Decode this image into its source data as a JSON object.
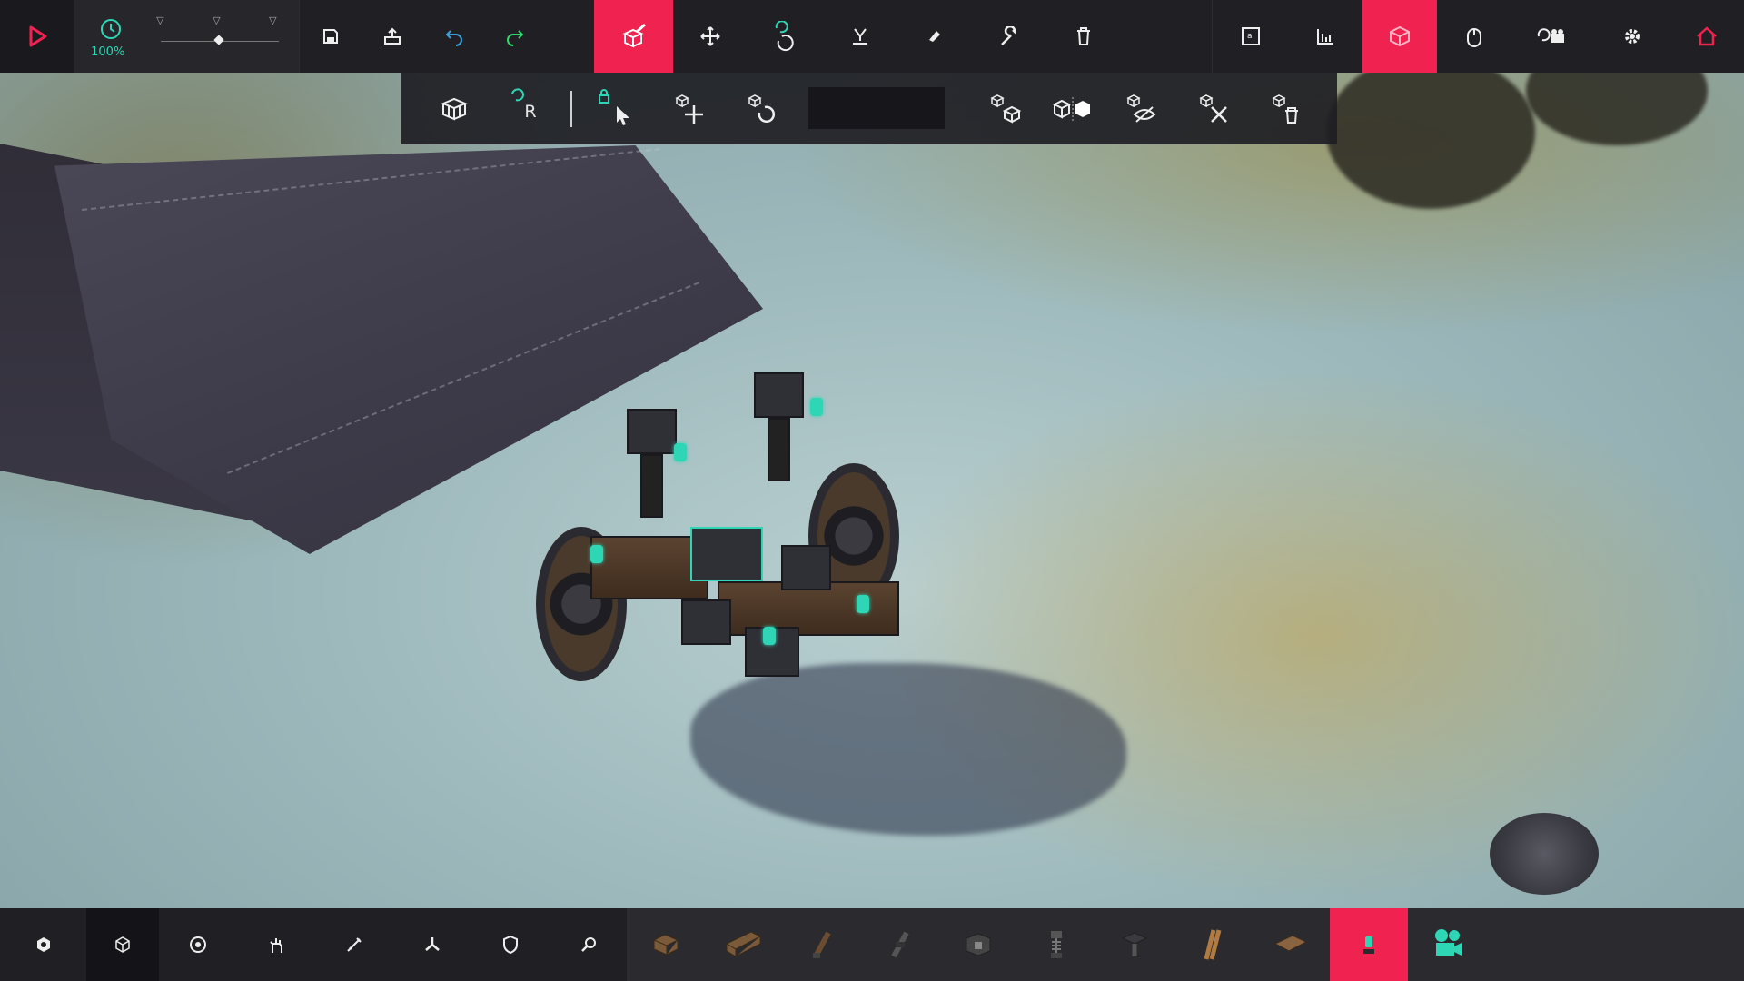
{
  "app": {
    "accent": "#f0224f",
    "teal": "#2ed6b5"
  },
  "topbar": {
    "play": "play-icon",
    "time_scale_label": "100%",
    "undo": "undo-icon",
    "redo": "redo-icon",
    "tools": [
      "build-icon",
      "move-icon",
      "rotate-icon",
      "snap-icon",
      "paint-icon",
      "wrench-icon",
      "delete-icon"
    ],
    "right": [
      "text-icon",
      "stats-icon",
      "cube-view-icon",
      "mouse-icon",
      "camera-orbit-icon",
      "settings-icon",
      "home-icon"
    ]
  },
  "subbar": {
    "rotate_label": "R",
    "search_value": ""
  },
  "bottombar": {
    "categories": [
      "basic",
      "blocks",
      "mechanical",
      "weapons",
      "flight",
      "armour",
      "utility",
      "automation"
    ],
    "selected_category": "blocks"
  }
}
